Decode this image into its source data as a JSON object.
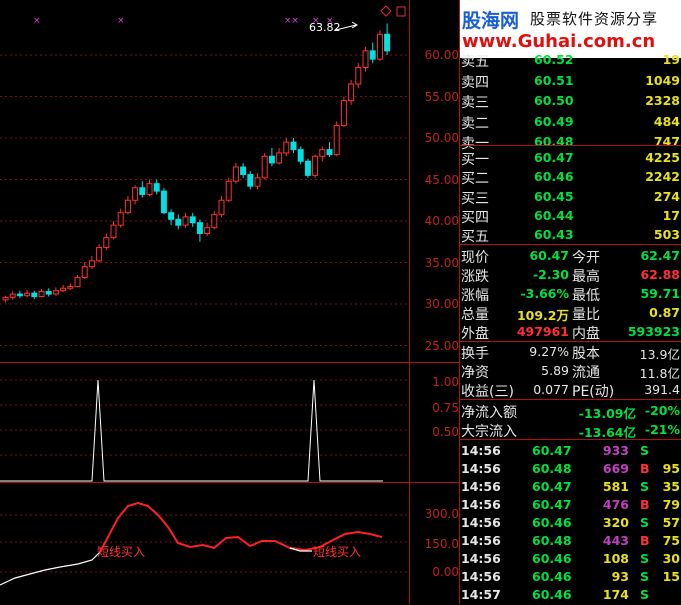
{
  "brand": {
    "logo_text": "股海网",
    "slogan": "股票软件资源分享",
    "url": "www.Guhai.com.cn"
  },
  "colors": {
    "up": "#ff3030",
    "down": "#00e0e0",
    "grid": "#b01010",
    "green": "#00e040",
    "yellow": "#e8e020",
    "white": "#ffffff"
  },
  "main_chart": {
    "high_marker": "63.82",
    "price_axis": [
      "60.00",
      "55.00",
      "50.00",
      "45.00",
      "40.00",
      "35.00",
      "30.00",
      "25.00"
    ]
  },
  "indicator1": {
    "axis": [
      "1.00",
      "0.75",
      "0.50",
      "0.25"
    ]
  },
  "indicator2": {
    "axis": [
      "300.0",
      "150.0",
      "0.00"
    ],
    "signals": [
      "短线买入",
      "短线买入"
    ]
  },
  "order_book": [
    {
      "label": "卖五",
      "price": "60.52",
      "vol": "19"
    },
    {
      "label": "卖四",
      "price": "60.51",
      "vol": "1049"
    },
    {
      "label": "卖三",
      "price": "60.50",
      "vol": "2328"
    },
    {
      "label": "卖二",
      "price": "60.49",
      "vol": "484"
    },
    {
      "label": "卖一",
      "price": "60.48",
      "vol": "747"
    },
    {
      "label": "买一",
      "price": "60.47",
      "vol": "4225"
    },
    {
      "label": "买二",
      "price": "60.46",
      "vol": "2242"
    },
    {
      "label": "买三",
      "price": "60.45",
      "vol": "274"
    },
    {
      "label": "买四",
      "price": "60.44",
      "vol": "17"
    },
    {
      "label": "买五",
      "price": "60.43",
      "vol": "503"
    }
  ],
  "quote": [
    {
      "l1": "现价",
      "v1": "60.47",
      "l2": "今开",
      "v2": "62.47"
    },
    {
      "l1": "涨跌",
      "v1": "-2.30",
      "l2": "最高",
      "v2": "62.88"
    },
    {
      "l1": "涨幅",
      "v1": "-3.66%",
      "l2": "最低",
      "v2": "59.71"
    },
    {
      "l1": "总量",
      "v1": "109.2万",
      "l2": "量比",
      "v2": "0.87"
    },
    {
      "l1": "外盘",
      "v1": "497961",
      "l2": "内盘",
      "v2": "593923"
    }
  ],
  "fundamentals": [
    {
      "l1": "换手",
      "v1": "9.27%",
      "l2": "股本",
      "v2": "13.9亿"
    },
    {
      "l1": "净资",
      "v1": "5.89",
      "l2": "流通",
      "v2": "11.8亿"
    },
    {
      "l1": "收益(三)",
      "v1": "0.077",
      "l2": "PE(动)",
      "v2": "391.4"
    }
  ],
  "flows": [
    {
      "label": "净流入额",
      "value": "-13.09亿",
      "pct": "-20%"
    },
    {
      "label": "大宗流入",
      "value": "-13.64亿",
      "pct": "-21%"
    }
  ],
  "ticks": [
    {
      "time": "14:56",
      "price": "60.47",
      "vol": "933",
      "side": "S"
    },
    {
      "time": "14:56",
      "price": "60.48",
      "vol": "669",
      "side": "B",
      "n": "95"
    },
    {
      "time": "14:56",
      "price": "60.47",
      "vol": "581",
      "side": "S",
      "n": "35"
    },
    {
      "time": "14:56",
      "price": "60.47",
      "vol": "476",
      "side": "B",
      "n": "79"
    },
    {
      "time": "14:56",
      "price": "60.46",
      "vol": "320",
      "side": "S",
      "n": "57"
    },
    {
      "time": "14:56",
      "price": "60.48",
      "vol": "443",
      "side": "B",
      "n": "75"
    },
    {
      "time": "14:56",
      "price": "60.46",
      "vol": "108",
      "side": "S",
      "n": "30"
    },
    {
      "time": "14:56",
      "price": "60.46",
      "vol": "93",
      "side": "S",
      "n": "15"
    },
    {
      "time": "14:57",
      "price": "60.46",
      "vol": "174",
      "side": "S"
    }
  ]
}
